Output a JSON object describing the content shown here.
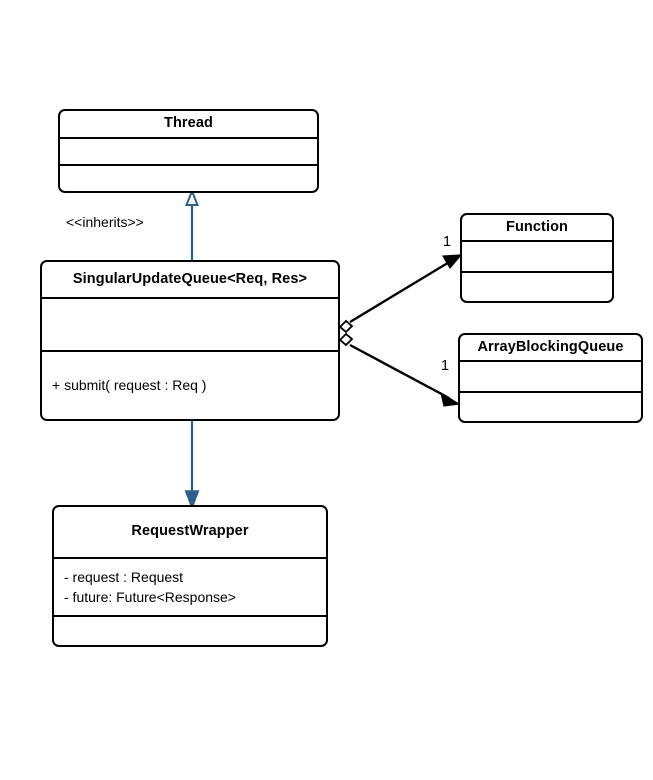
{
  "diagram": {
    "type": "uml-class-diagram",
    "title": "SingularUpdateQueue UML class diagram",
    "background_color": "#ffffff",
    "stroke_color": "#000000",
    "inheritance_color": "#2e5f8a"
  },
  "classes": {
    "thread": {
      "name": "Thread",
      "attributes": [],
      "methods": []
    },
    "singular_update_queue": {
      "name": "SingularUpdateQueue<Req, Res>",
      "attributes": [],
      "methods": [
        "+ submit( request : Req )"
      ]
    },
    "request_wrapper": {
      "name": "RequestWrapper",
      "attributes": [
        "- request : Request",
        "- future: Future<Response>"
      ],
      "methods": []
    },
    "function": {
      "name": "Function",
      "attributes": [],
      "methods": []
    },
    "array_blocking_queue": {
      "name": "ArrayBlockingQueue",
      "attributes": [],
      "methods": []
    }
  },
  "relationships": {
    "inherits": {
      "label": "<<inherits>>",
      "from": "SingularUpdateQueue<Req, Res>",
      "to": "Thread",
      "kind": "generalization"
    },
    "creates": {
      "label": "",
      "from": "SingularUpdateQueue<Req, Res>",
      "to": "RequestWrapper",
      "kind": "directed-association"
    },
    "has_function": {
      "multiplicity": "1",
      "from": "SingularUpdateQueue<Req, Res>",
      "to": "Function",
      "kind": "aggregation"
    },
    "has_queue": {
      "multiplicity": "1",
      "from": "SingularUpdateQueue<Req, Res>",
      "to": "ArrayBlockingQueue",
      "kind": "aggregation"
    }
  }
}
